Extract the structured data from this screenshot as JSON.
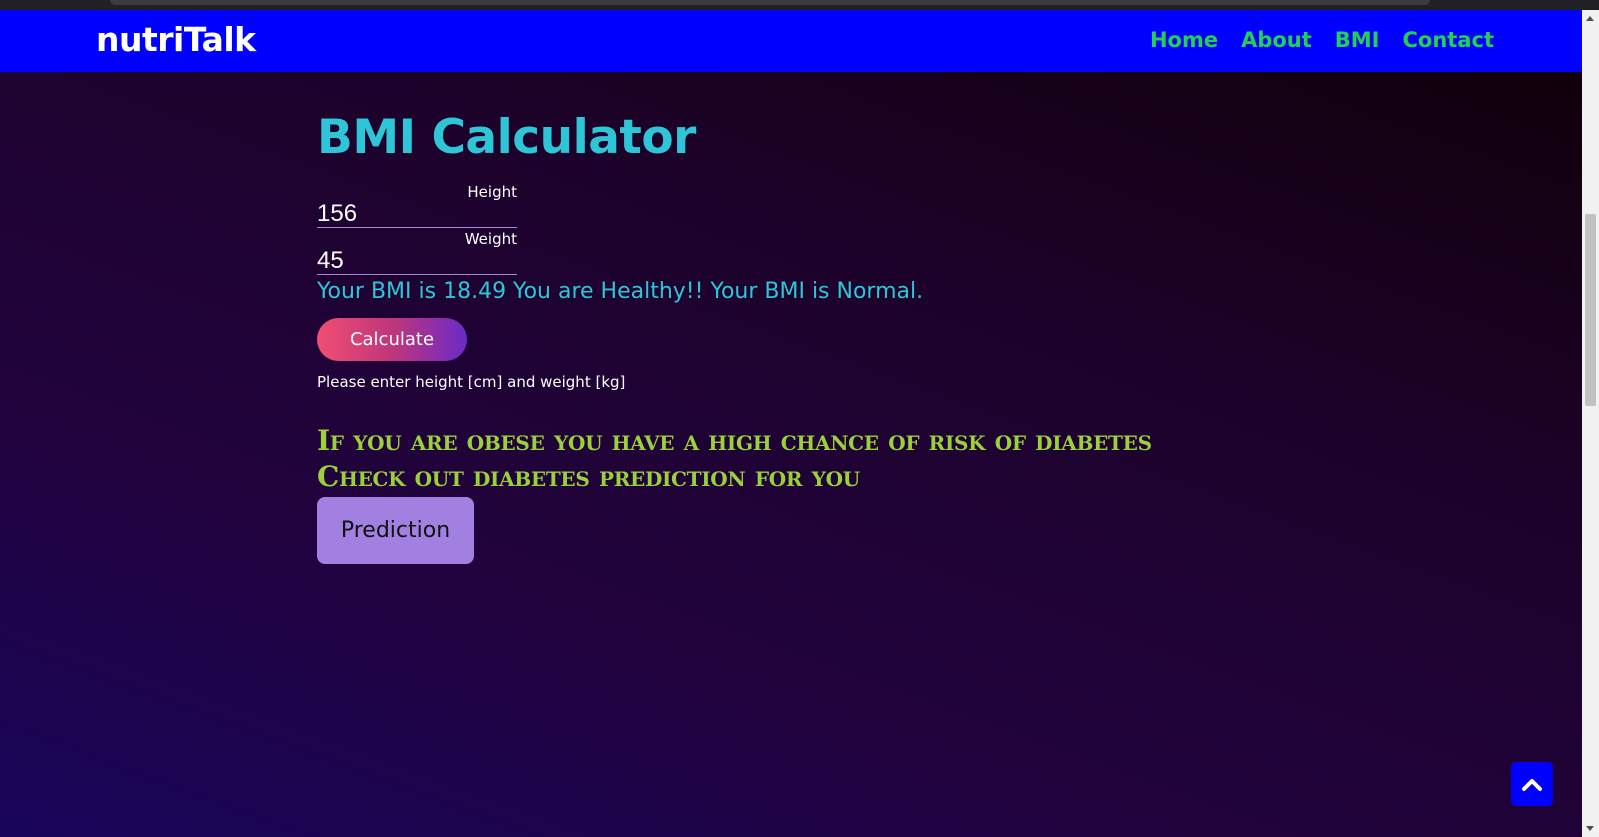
{
  "nav": {
    "brand": "nutriTalk",
    "links": [
      "Home",
      "About",
      "BMI",
      "Contact"
    ]
  },
  "bmi": {
    "title": "BMI Calculator",
    "height_label": "Height",
    "height_value": "156",
    "weight_label": "Weight",
    "weight_value": "45",
    "result": "Your BMI is 18.49 You are Healthy!! Your BMI is Normal.",
    "calculate_label": "Calculate",
    "note": "Please enter height [cm] and weight [kg]"
  },
  "promo": {
    "line1": "If you are obese you have a high chance of risk of diabetes",
    "line2": "Check out diabetes prediction for you",
    "prediction_label": "Prediction"
  },
  "icons": {
    "scroll_top": "chevron-up-icon"
  },
  "colors": {
    "navbar": "#0000fe",
    "nav_link": "#22d150",
    "title": "#2ec6d6",
    "promo": "#9ad03a",
    "prediction_button": "#a280e2"
  }
}
